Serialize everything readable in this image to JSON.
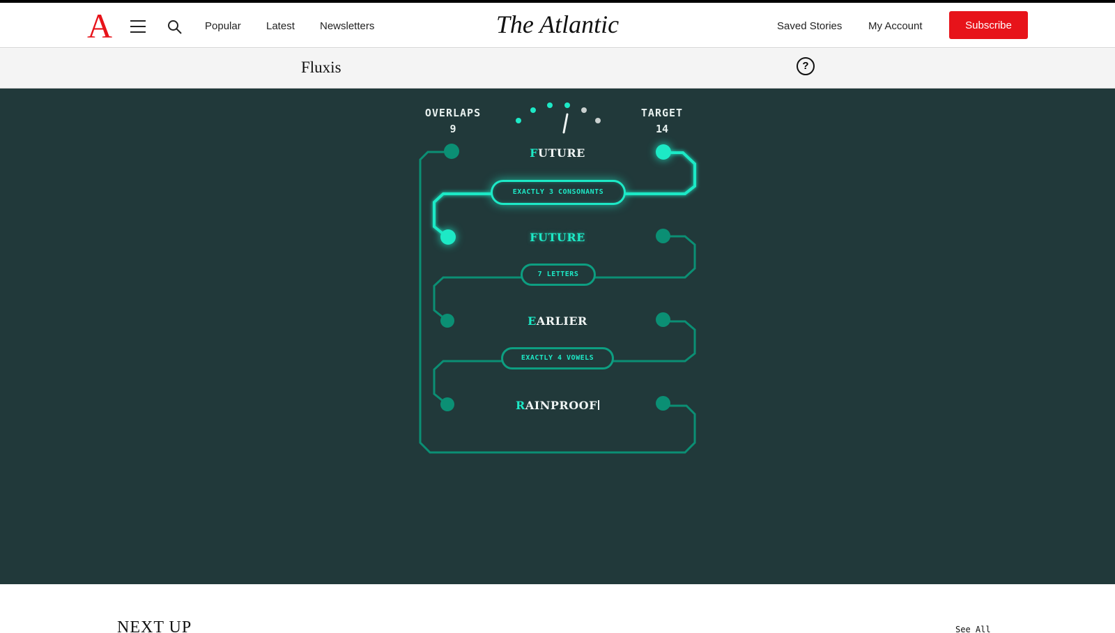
{
  "header": {
    "logo": "A",
    "brand": "The Atlantic",
    "nav": [
      "Popular",
      "Latest",
      "Newsletters"
    ],
    "saved_stories": "Saved Stories",
    "my_account": "My Account",
    "subscribe": "Subscribe",
    "accent_color": "#e7131a"
  },
  "game_bar": {
    "title": "Fluxis",
    "help": "?"
  },
  "game": {
    "overlaps_label": "OVERLAPS",
    "overlaps_value": "9",
    "target_label": "TARGET",
    "target_value": "14",
    "progress_dots": {
      "filled": 3,
      "total": 5
    },
    "words": [
      {
        "first": "F",
        "rest": "UTURE"
      },
      {
        "full": "FUTURE"
      },
      {
        "first": "E",
        "rest": "ARLIER"
      },
      {
        "first": "R",
        "rest": "AINPROOF"
      }
    ],
    "rules": [
      "EXACTLY 3 CONSONANTS",
      "7 LETTERS",
      "EXACTLY 4 VOWELS"
    ],
    "colors": {
      "background": "#21393a",
      "accent": "#1de9c6",
      "dim": "#0b8f74"
    }
  },
  "next_up": {
    "title": "NEXT UP",
    "see_all": "See All"
  }
}
